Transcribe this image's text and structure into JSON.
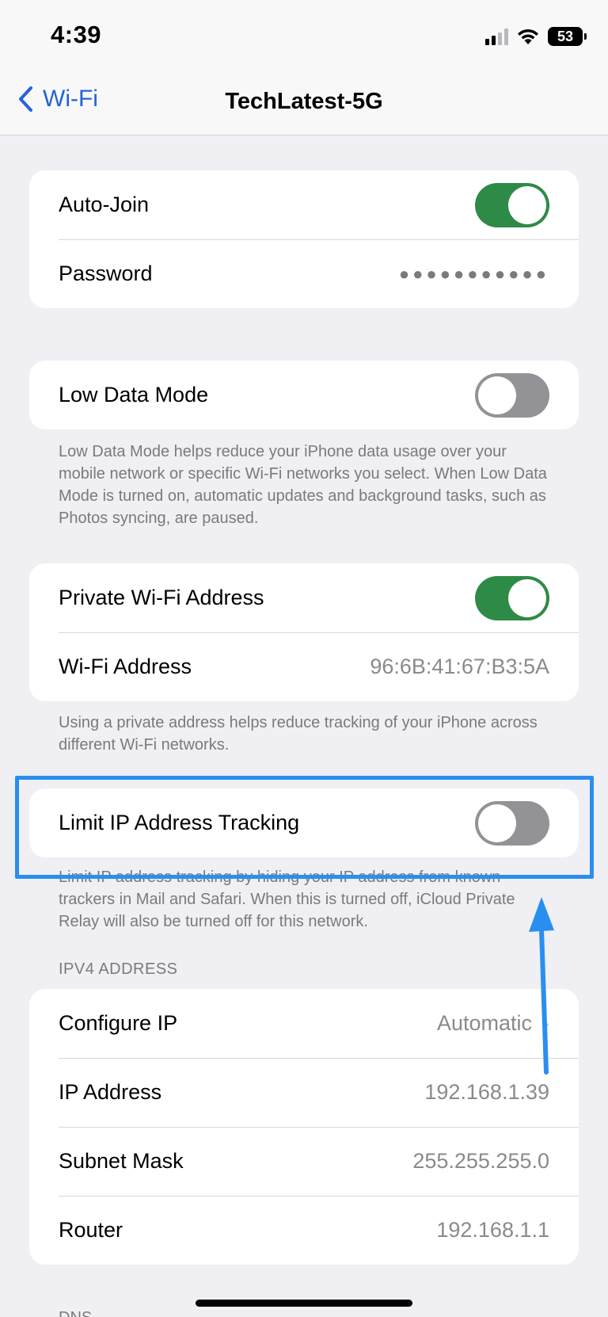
{
  "status_bar": {
    "time": "4:39",
    "battery": "53"
  },
  "nav": {
    "back_label": "Wi-Fi",
    "title": "TechLatest-5G"
  },
  "group1": {
    "auto_join_label": "Auto-Join",
    "auto_join_on": true,
    "password_label": "Password",
    "password_value": "●●●●●●●●●●●"
  },
  "group2": {
    "low_data_label": "Low Data Mode",
    "low_data_on": false,
    "footnote": "Low Data Mode helps reduce your iPhone data usage over your mobile network or specific Wi-Fi networks you select. When Low Data Mode is turned on, automatic updates and background tasks, such as Photos syncing, are paused."
  },
  "group3": {
    "private_label": "Private Wi-Fi Address",
    "private_on": true,
    "address_label": "Wi-Fi Address",
    "address_value": "96:6B:41:67:B3:5A",
    "footnote": "Using a private address helps reduce tracking of your iPhone across different Wi-Fi networks."
  },
  "group4": {
    "limit_label": "Limit IP Address Tracking",
    "limit_on": false,
    "footnote": "Limit IP address tracking by hiding your IP address from known trackers in Mail and Safari. When this is turned off, iCloud Private Relay will also be turned off for this network."
  },
  "ipv4": {
    "header": "IPV4 ADDRESS",
    "rows": [
      {
        "label": "Configure IP",
        "value": "Automatic"
      },
      {
        "label": "IP Address",
        "value": "192.168.1.39"
      },
      {
        "label": "Subnet Mask",
        "value": "255.255.255.0"
      },
      {
        "label": "Router",
        "value": "192.168.1.1"
      }
    ]
  },
  "dns_header": "DNS",
  "colors": {
    "toggle_on": "#2e8a47",
    "toggle_off": "#929297",
    "accent": "#2563d8",
    "annotation": "#2a8ef0"
  }
}
